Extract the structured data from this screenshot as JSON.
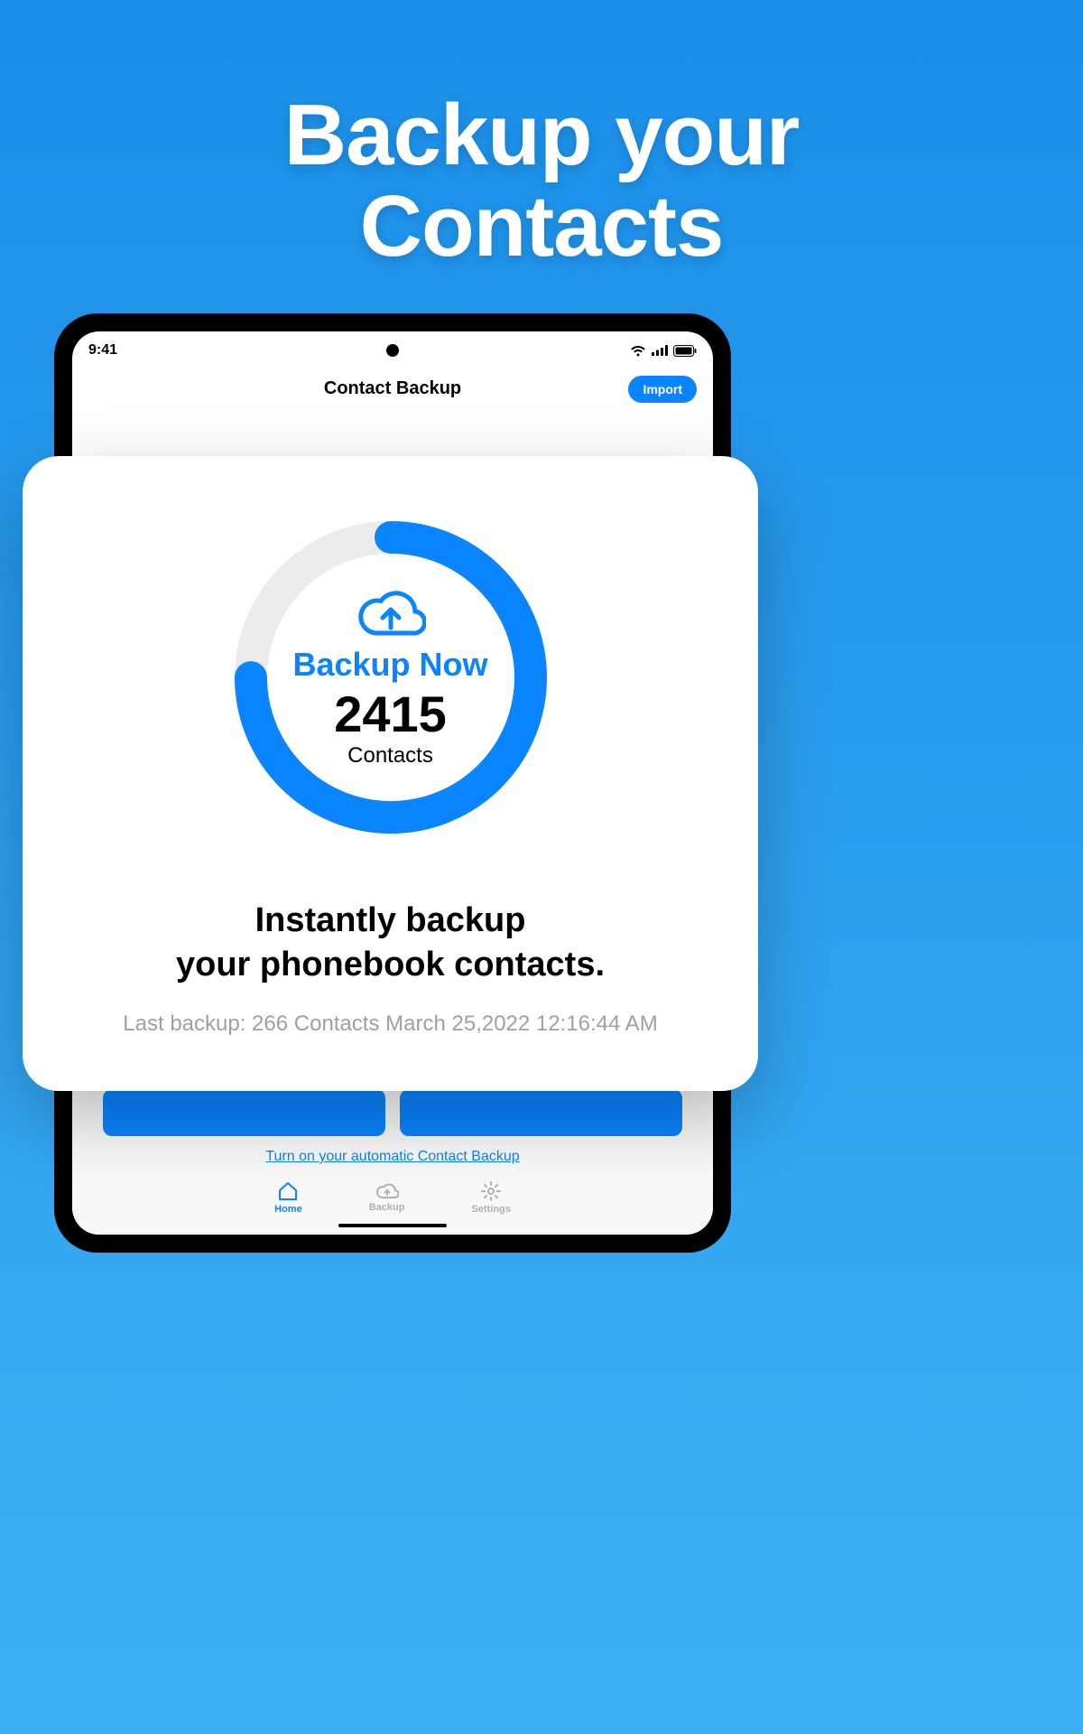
{
  "hero": {
    "line1": "Backup your",
    "line2": "Contacts"
  },
  "statusBar": {
    "time": "9:41"
  },
  "navBar": {
    "title": "Contact Backup",
    "importLabel": "Import"
  },
  "ring": {
    "actionLabel": "Backup Now",
    "count": "2415",
    "unit": "Contacts",
    "progressPercent": 75
  },
  "card": {
    "headlineLine1": "Instantly backup",
    "headlineLine2": "your phonebook contacts.",
    "lastBackup": "Last backup: 266 Contacts March 25,2022 12:16:44 AM"
  },
  "autoBackupLink": "Turn on your automatic Contact Backup",
  "tabs": {
    "home": "Home",
    "backup": "Backup",
    "settings": "Settings"
  },
  "colors": {
    "accent": "#0a84ff",
    "ringTrack": "#ececec"
  }
}
